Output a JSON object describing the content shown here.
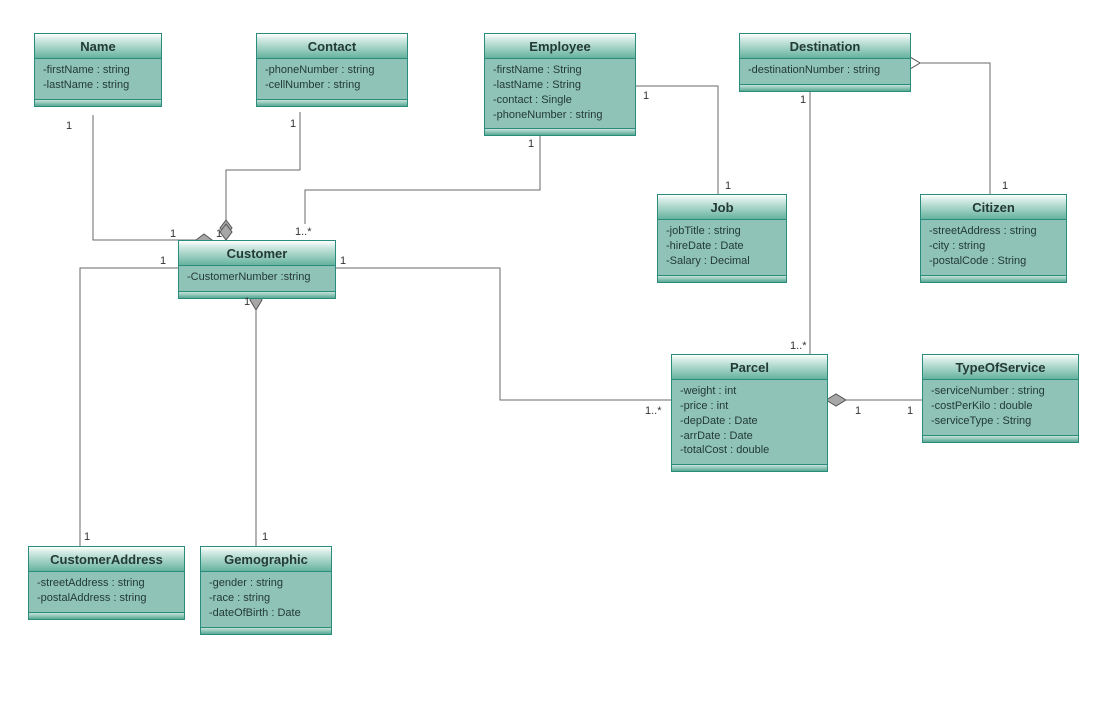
{
  "classes": {
    "name": {
      "title": "Name",
      "attrs": [
        "-firstName : string",
        "-lastName : string"
      ]
    },
    "contact": {
      "title": "Contact",
      "attrs": [
        "-phoneNumber : string",
        "-cellNumber : string"
      ]
    },
    "employee": {
      "title": "Employee",
      "attrs": [
        "-firstName : String",
        "-lastName : String",
        "-contact : Single",
        "-phoneNumber : string"
      ]
    },
    "destination": {
      "title": "Destination",
      "attrs": [
        "-destinationNumber : string"
      ]
    },
    "job": {
      "title": "Job",
      "attrs": [
        "-jobTitle : string",
        "-hireDate : Date",
        "-Salary : Decimal"
      ]
    },
    "citizen": {
      "title": "Citizen",
      "attrs": [
        "-streetAddress : string",
        "-city : string",
        "-postalCode : String"
      ]
    },
    "customer": {
      "title": "Customer",
      "attrs": [
        "-CustomerNumber :string"
      ]
    },
    "parcel": {
      "title": "Parcel",
      "attrs": [
        "-weight : int",
        "-price : int",
        "-depDate : Date",
        "-arrDate : Date",
        "-totalCost : double"
      ]
    },
    "typeOfService": {
      "title": "TypeOfService",
      "attrs": [
        "-serviceNumber : string",
        "-costPerKilo : double",
        "-serviceType : String"
      ]
    },
    "customerAddress": {
      "title": "CustomerAddress",
      "attrs": [
        "-streetAddress : string",
        "-postalAddress : string"
      ]
    },
    "gemographic": {
      "title": "Gemographic",
      "attrs": [
        "-gender : string",
        "-race : string",
        "-dateOfBirth : Date"
      ]
    }
  },
  "mult": {
    "one": "1",
    "oneStar": "1..*"
  },
  "chart_data": {
    "type": "diagram",
    "diagram_kind": "uml-class",
    "classes": [
      {
        "id": "Name",
        "attributes": [
          "firstName : string",
          "lastName : string"
        ]
      },
      {
        "id": "Contact",
        "attributes": [
          "phoneNumber : string",
          "cellNumber : string"
        ]
      },
      {
        "id": "Employee",
        "attributes": [
          "firstName : String",
          "lastName : String",
          "contact : Single",
          "phoneNumber : string"
        ]
      },
      {
        "id": "Destination",
        "attributes": [
          "destinationNumber : string"
        ]
      },
      {
        "id": "Job",
        "attributes": [
          "jobTitle : string",
          "hireDate : Date",
          "Salary : Decimal"
        ]
      },
      {
        "id": "Citizen",
        "attributes": [
          "streetAddress : string",
          "city : string",
          "postalCode : String"
        ]
      },
      {
        "id": "Customer",
        "attributes": [
          "CustomerNumber : string"
        ]
      },
      {
        "id": "Parcel",
        "attributes": [
          "weight : int",
          "price : int",
          "depDate : Date",
          "arrDate : Date",
          "totalCost : double"
        ]
      },
      {
        "id": "TypeOfService",
        "attributes": [
          "serviceNumber : string",
          "costPerKilo : double",
          "serviceType : String"
        ]
      },
      {
        "id": "CustomerAddress",
        "attributes": [
          "streetAddress : string",
          "postalAddress : string"
        ]
      },
      {
        "id": "Gemographic",
        "attributes": [
          "gender : string",
          "race : string",
          "dateOfBirth : Date"
        ]
      }
    ],
    "relationships": [
      {
        "from": "Customer",
        "to": "Name",
        "type": "aggregation-filled",
        "mult_from": "1",
        "mult_to": "1"
      },
      {
        "from": "Customer",
        "to": "Contact",
        "type": "aggregation-filled",
        "mult_from": "1",
        "mult_to": "1"
      },
      {
        "from": "Customer",
        "to": "Employee",
        "type": "association",
        "mult_from": "1..*",
        "mult_to": "1"
      },
      {
        "from": "Customer",
        "to": "CustomerAddress",
        "type": "association",
        "mult_from": "1",
        "mult_to": "1"
      },
      {
        "from": "Customer",
        "to": "Gemographic",
        "type": "aggregation-filled",
        "mult_from": "1",
        "mult_to": "1"
      },
      {
        "from": "Customer",
        "to": "Parcel",
        "type": "association",
        "mult_from": "1",
        "mult_to": "1..*"
      },
      {
        "from": "Employee",
        "to": "Job",
        "type": "aggregation-empty",
        "mult_from": "1",
        "mult_to": "1"
      },
      {
        "from": "Destination",
        "to": "Citizen",
        "type": "aggregation-empty",
        "mult_from": "1",
        "mult_to": "1"
      },
      {
        "from": "Destination",
        "to": "Parcel",
        "type": "association",
        "mult_from": "1",
        "mult_to": "1..*"
      },
      {
        "from": "Parcel",
        "to": "TypeOfService",
        "type": "aggregation-filled",
        "mult_from": "1",
        "mult_to": "1"
      }
    ]
  }
}
